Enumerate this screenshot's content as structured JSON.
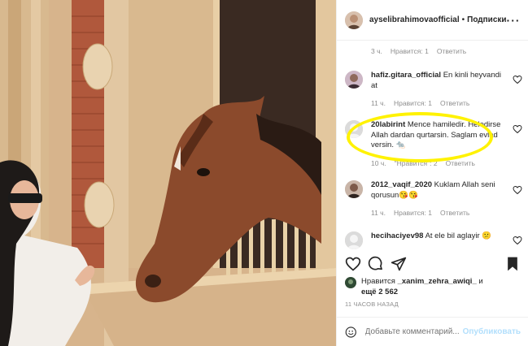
{
  "header": {
    "username": "ayselibrahimovaofficial",
    "dot": "•",
    "follow_label": "Подписки",
    "more_label": "···"
  },
  "comments": [
    {
      "user": "",
      "text": "",
      "time": "3 ч.",
      "likes": "Нравится: 1",
      "reply": "Ответить"
    },
    {
      "user": "hafiz.gitara_official",
      "text": "En kinli heyvandi at",
      "time": "11 ч.",
      "likes": "Нравится: 1",
      "reply": "Ответить"
    },
    {
      "user": "20labirint",
      "text": "Mence hamiledir. Heledirse Allah dardan qurtarsin. Saglam evlad versin. 🐀",
      "time": "10 ч.",
      "likes": "\"Нравится\": 2",
      "reply": "Ответить"
    },
    {
      "user": "2012_vaqif_2020",
      "text": "Kuklam Allah seni qorusun😘😘",
      "time": "11 ч.",
      "likes": "Нравится: 1",
      "reply": "Ответить"
    },
    {
      "user": "hecihaciyev98",
      "text": "At ele bil aglayir 😕",
      "time": "",
      "likes": "",
      "reply": ""
    }
  ],
  "likes": {
    "prefix": "Нравится ",
    "user": "_xanim_zehra_awiqi_",
    "middle": " и",
    "line2_prefix": "ещё ",
    "count": "2 562"
  },
  "timestamp": "11 ЧАСОВ НАЗАД",
  "add_comment": {
    "placeholder": "Добавьте комментарий...",
    "publish": "Опубликовать"
  },
  "colors": {
    "highlight": "#fff200",
    "publish": "#b2dffc"
  }
}
